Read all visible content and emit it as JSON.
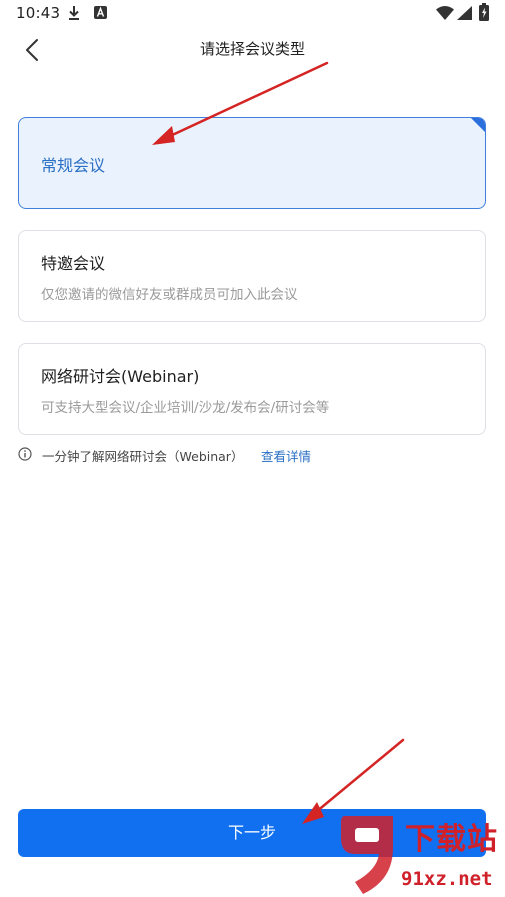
{
  "status_bar": {
    "time": "10:43",
    "left_icons": [
      "download-icon",
      "a-badge-icon"
    ],
    "right_icons": [
      "wifi-icon",
      "signal-icon",
      "battery-charging-icon"
    ]
  },
  "header": {
    "title": "请选择会议类型",
    "back_icon": "chevron-left-icon"
  },
  "options": [
    {
      "title": "常规会议",
      "description": "",
      "selected": true
    },
    {
      "title": "特邀会议",
      "description": "仅您邀请的微信好友或群成员可加入此会议",
      "selected": false
    },
    {
      "title": "网络研讨会(Webinar)",
      "description": "可支持大型会议/企业培训/沙龙/发布会/研讨会等",
      "selected": false
    }
  ],
  "info": {
    "icon": "info-circle-icon",
    "text": "一分钟了解网络研讨会（Webinar）",
    "link": "查看详情"
  },
  "footer": {
    "next_label": "下一步"
  },
  "watermark": {
    "logo_number": "9",
    "text_top": "下载站",
    "text_bottom": "91xz.net"
  },
  "colors": {
    "accent": "#1070f0",
    "selected_bg": "#eaf2fd",
    "selected_border": "#3f80df",
    "link": "#2a6fc4",
    "annotation_arrow": "#d42424",
    "watermark": "#d0202a"
  }
}
